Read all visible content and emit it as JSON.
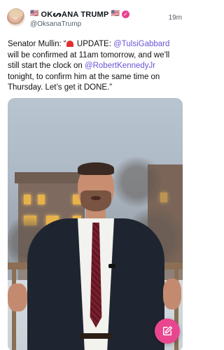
{
  "post": {
    "author": {
      "flag_left": "🇺🇸",
      "display_name": "OKᔕANA TRUMP",
      "flag_right": "🇺🇸",
      "verified_badge": "✓",
      "handle": "@OksanaTrump"
    },
    "timestamp": "19m",
    "text": {
      "part1": "Senator Mullin: “",
      "siren_icon": "siren-icon",
      "part2": " UPDATE: ",
      "mention1": "@TulsiGabbard",
      "part3": " will be confirmed at 11am tomorrow, and we’ll still start the clock on ",
      "mention2": "@RobertKennedyJr",
      "part4": " tonight, to confirm him at the same time on Thursday. Let’s get it DONE.”"
    },
    "media": {
      "type": "video-thumbnail"
    }
  },
  "compose_button": {
    "icon": "compose-icon"
  },
  "colors": {
    "accent_link": "#6b54d6",
    "fab": "#e9468f",
    "verified": "#e6428f",
    "text": "#0f1419",
    "muted": "#55606a"
  }
}
